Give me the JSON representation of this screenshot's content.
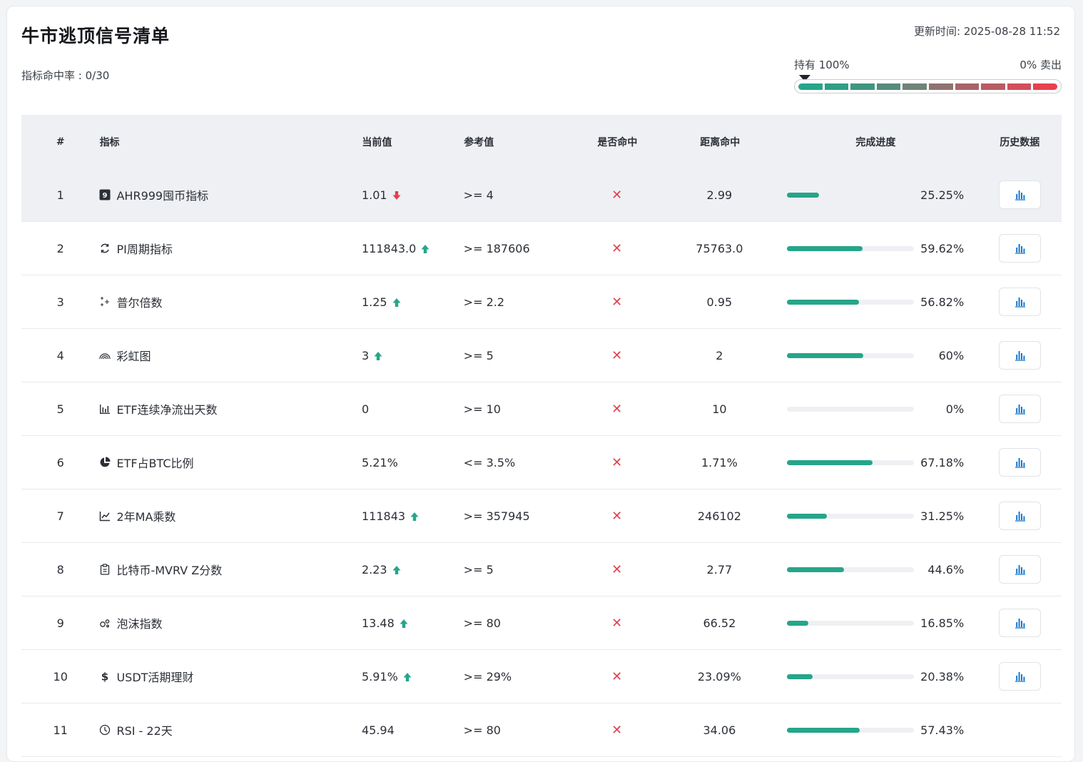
{
  "header": {
    "title": "牛市逃顶信号清单",
    "hit_rate": "指标命中率 : 0/30",
    "update_time": "更新时间: 2025-08-28 11:52"
  },
  "gauge": {
    "left_label": "持有 100%",
    "right_label": "0% 卖出",
    "position_fraction": 0.0,
    "segment_colors": [
      "#26a58a",
      "#2f9e84",
      "#3f9680",
      "#558c7c",
      "#6f8478",
      "#8f7270",
      "#a86468",
      "#b95a62",
      "#d24e5b",
      "#e8404f"
    ]
  },
  "table": {
    "columns": [
      "#",
      "指标",
      "当前值",
      "参考值",
      "是否命中",
      "距离命中",
      "完成进度",
      "历史数据"
    ],
    "hit_symbol": "✕",
    "colors": {
      "up": "#26a58a",
      "down": "#e0414f",
      "progress": "#26a58a"
    },
    "rows": [
      {
        "num": "1",
        "icon": "nine-badge-icon",
        "name": "AHR999囤币指标",
        "current": "1.01",
        "trend": "down",
        "ref": ">= 4",
        "distance": "2.99",
        "progress": 25.25,
        "progress_label": "25.25%",
        "history": true
      },
      {
        "num": "2",
        "icon": "cycle-icon",
        "name": "PI周期指标",
        "current": "111843.0",
        "trend": "up",
        "ref": ">= 187606",
        "distance": "75763.0",
        "progress": 59.62,
        "progress_label": "59.62%",
        "history": true
      },
      {
        "num": "3",
        "icon": "sparkle-icon",
        "name": "普尔倍数",
        "current": "1.25",
        "trend": "up",
        "ref": ">= 2.2",
        "distance": "0.95",
        "progress": 56.82,
        "progress_label": "56.82%",
        "history": true
      },
      {
        "num": "4",
        "icon": "rainbow-icon",
        "name": "彩虹图",
        "current": "3",
        "trend": "up",
        "ref": ">= 5",
        "distance": "2",
        "progress": 60,
        "progress_label": "60%",
        "history": true
      },
      {
        "num": "5",
        "icon": "bar-chart-icon",
        "name": "ETF连续净流出天数",
        "current": "0",
        "trend": "",
        "ref": ">= 10",
        "distance": "10",
        "progress": 0,
        "progress_label": "0%",
        "history": true
      },
      {
        "num": "6",
        "icon": "pie-chart-icon",
        "name": "ETF占BTC比例",
        "current": "5.21%",
        "trend": "",
        "ref": "<= 3.5%",
        "distance": "1.71%",
        "progress": 67.18,
        "progress_label": "67.18%",
        "history": true
      },
      {
        "num": "7",
        "icon": "line-chart-icon",
        "name": "2年MA乘数",
        "current": "111843",
        "trend": "up",
        "ref": ">= 357945",
        "distance": "246102",
        "progress": 31.25,
        "progress_label": "31.25%",
        "history": true
      },
      {
        "num": "8",
        "icon": "clipboard-icon",
        "name": "比特币-MVRV Z分数",
        "current": "2.23",
        "trend": "up",
        "ref": ">= 5",
        "distance": "2.77",
        "progress": 44.6,
        "progress_label": "44.6%",
        "history": true
      },
      {
        "num": "9",
        "icon": "bubbles-icon",
        "name": "泡沫指数",
        "current": "13.48",
        "trend": "up",
        "ref": ">= 80",
        "distance": "66.52",
        "progress": 16.85,
        "progress_label": "16.85%",
        "history": true
      },
      {
        "num": "10",
        "icon": "dollar-icon",
        "name": "USDT活期理财",
        "current": "5.91%",
        "trend": "up",
        "ref": ">= 29%",
        "distance": "23.09%",
        "progress": 20.38,
        "progress_label": "20.38%",
        "history": true
      },
      {
        "num": "11",
        "icon": "clock-icon",
        "name": "RSI - 22天",
        "current": "45.94",
        "trend": "",
        "ref": ">= 80",
        "distance": "34.06",
        "progress": 57.43,
        "progress_label": "57.43%",
        "history": false
      }
    ]
  }
}
